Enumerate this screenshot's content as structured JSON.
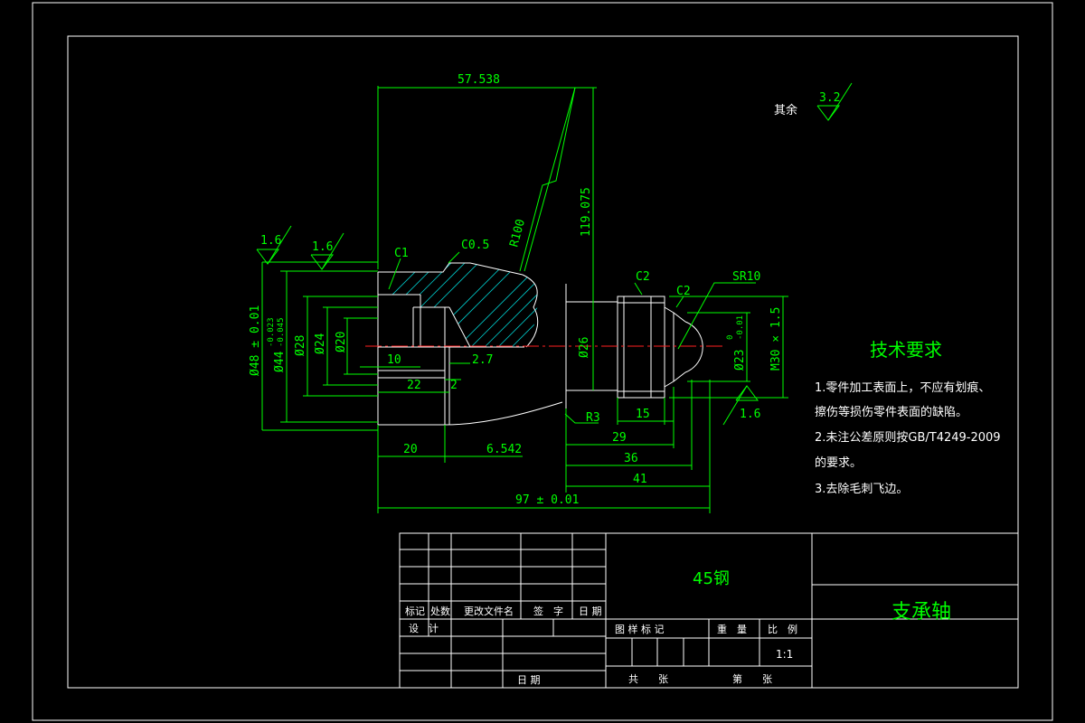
{
  "drawing": {
    "part_name": "支承轴",
    "material": "45钢",
    "scale": "1:1"
  },
  "surface_finish": {
    "general_label": "其余",
    "general_value": "3.2",
    "left_outer": "1.6",
    "left_inner": "1.6",
    "thread_end": "1.6"
  },
  "dimensions": {
    "top_width": "57.538",
    "height": "119.075",
    "radius_large": "R100",
    "chamfer_c1": "C1",
    "chamfer_c05": "C0.5",
    "chamfer_c2_left": "C2",
    "chamfer_c2_right": "C2",
    "sphere_radius": "SR10",
    "dia_48": "Ø48 ± 0.01",
    "dia_44": "Ø44",
    "dia_44_tol_upper": "-0.023",
    "dia_44_tol_lower": "-0.045",
    "dia_28": "Ø28",
    "dia_24": "Ø24",
    "dia_20": "Ø20",
    "dia_26": "Ø26",
    "dia_23": "Ø23",
    "dia_23_tol_upper": "0",
    "dia_23_tol_lower": "-0.01",
    "thread": "M30 × 1.5",
    "len_10": "10",
    "len_22": "22",
    "len_2": "2",
    "len_2_7": "2.7",
    "len_20": "20",
    "len_6_542": "6.542",
    "fillet_r3": "R3",
    "len_15": "15",
    "len_29": "29",
    "len_36": "36",
    "len_41": "41",
    "total_length": "97 ± 0.01"
  },
  "tech_requirements": {
    "title": "技术要求",
    "items": [
      "1.零件加工表面上，不应有划痕、",
      "擦伤等损伤零件表面的缺陷。",
      "2.未注公差原则按GB/T4249-2009",
      "的要求。",
      "3.去除毛刺飞边。"
    ]
  },
  "title_block": {
    "mark": "标记",
    "count": "处数",
    "change_doc": "更改文件名",
    "signature": "签　字",
    "date": "日 期",
    "design": "设　计",
    "sample_mark": "图 样 标 记",
    "weight": "重　量",
    "ratio": "比　例",
    "total_sheets": "共　　张",
    "sheet_no": "第　　张",
    "date_bottom": "日 期"
  },
  "colors": {
    "background": "#000000",
    "lines": "#00ff00",
    "outline": "#ffffff",
    "centerline": "#ff2020",
    "hatch": "#00c8c8"
  }
}
